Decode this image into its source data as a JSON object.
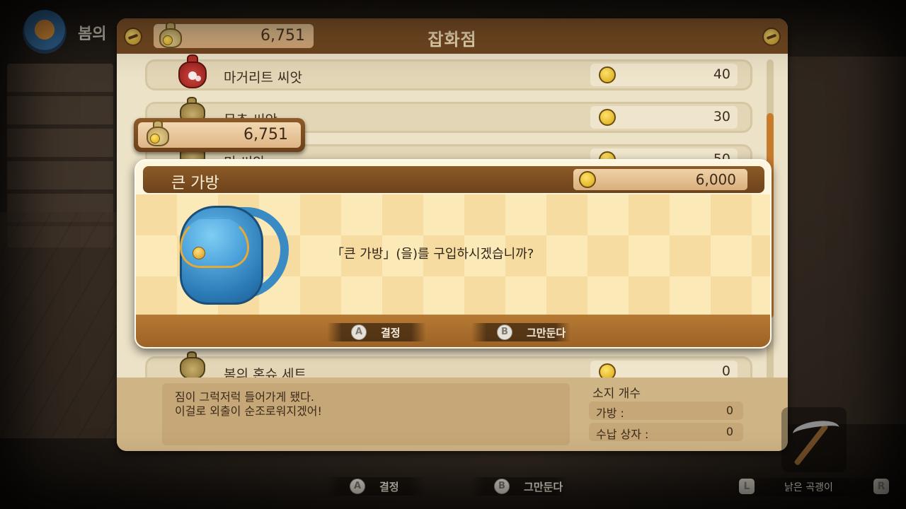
{
  "hud": {
    "season_label": "봄의"
  },
  "shop": {
    "title": "잡화점",
    "money": "6,751",
    "items": [
      {
        "name": "마거리트 씨앗",
        "price": "40",
        "icon": "seed-bag-red"
      },
      {
        "name": "무추 씨앗",
        "price": "30",
        "icon": "seed-bag-brown"
      },
      {
        "name": "미 씨앗",
        "price": "50",
        "icon": "seed-bag-brown"
      },
      {
        "name": "봄의 혼슈 세트",
        "price": "0",
        "icon": "seed-bag-brown"
      }
    ],
    "description": {
      "line1": "짐이 그럭저럭 들어가게 됐다.",
      "line2": "이걸로 외출이 순조로워지겠어!"
    },
    "owned": {
      "title": "소지 개수",
      "rows": [
        {
          "label": "가방 :",
          "value": "0"
        },
        {
          "label": "수납 상자 :",
          "value": "0"
        }
      ]
    }
  },
  "floating_money": "6,751",
  "dialog": {
    "item_name": "큰 가방",
    "price": "6,000",
    "message": "「큰 가방」(을)를 구입하시겠습니까?",
    "confirm_glyph": "A",
    "confirm_label": "결정",
    "cancel_glyph": "B",
    "cancel_label": "그만둔다"
  },
  "bottom_hints": {
    "confirm_glyph": "A",
    "confirm_label": "결정",
    "cancel_glyph": "B",
    "cancel_label": "그만둔다"
  },
  "tool": {
    "l_glyph": "L",
    "r_glyph": "R",
    "name": "낡은 곡괭이"
  }
}
